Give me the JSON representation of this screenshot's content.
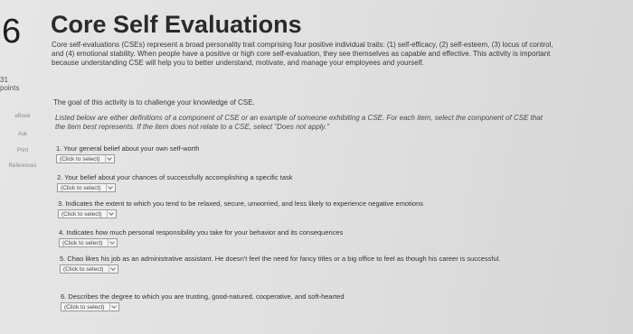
{
  "header": {
    "question_number": "6",
    "title": "Core Self Evaluations"
  },
  "sidebar": {
    "points_value": "31",
    "points_label": "points",
    "links": [
      "eBook",
      "Ask",
      "Print",
      "References"
    ]
  },
  "content": {
    "intro": "Core self-evaluations (CSEs) represent a broad personality trait comprising four positive individual traits: (1) self-efficacy, (2) self-esteem, (3) locus of control, and (4) emotional stability. When people have a positive or high core self-evaluation, they see themselves as capable and effective. This activity is important because understanding CSE will help you to better understand, motivate, and manage your employees and yourself.",
    "goal": "The goal of this activity is to challenge your knowledge of CSE.",
    "instructions": "Listed below are either definitions of a component of CSE or an example of someone exhibiting a CSE. For each item, select the component of CSE that the item best represents. If the item does not relate to a CSE, select \"Does not apply.\""
  },
  "items": [
    {
      "text": "1. Your general belief about your own self-worth",
      "select": "(Click to select)"
    },
    {
      "text": "2. Your belief about your chances of successfully accomplishing a specific task",
      "select": "(Click to select)"
    },
    {
      "text": "3. Indicates the extent to which you tend to be relaxed, secure, unworried, and less likely to experience negative emotions",
      "select": "(Click to select)"
    },
    {
      "text": "4. Indicates how much personal responsibility you take for your behavior and its consequences",
      "select": "(Click to select)"
    },
    {
      "text": "5. Chao likes his job as an administrative assistant. He doesn't feel the need for fancy titles or a big office to feel as though his career is successful.",
      "select": "(Click to select)"
    },
    {
      "text": "6. Describes the degree to which you are trusting, good-natured, cooperative, and soft-hearted",
      "select": "(Click to select)"
    }
  ]
}
